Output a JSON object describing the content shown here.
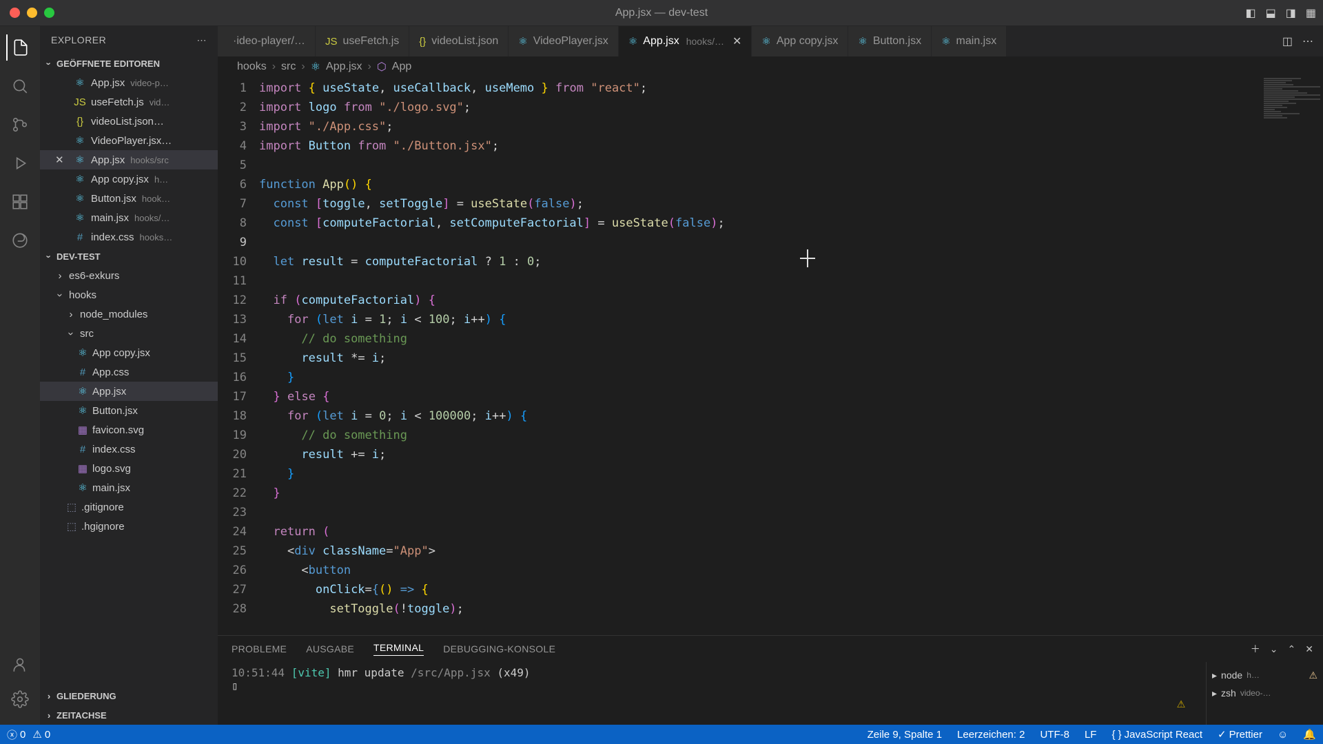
{
  "window": {
    "title": "App.jsx — dev-test"
  },
  "explorer": {
    "title": "EXPLORER",
    "openEditorsLabel": "GEÖFFNETE EDITOREN",
    "projectLabel": "DEV-TEST",
    "outlineLabel": "GLIEDERUNG",
    "timelineLabel": "ZEITACHSE",
    "openEditors": [
      {
        "name": "App.jsx",
        "hint": "video-p…",
        "iconCls": "ic-react",
        "glyph": "⚛"
      },
      {
        "name": "useFetch.js",
        "hint": "vid…",
        "iconCls": "ic-js",
        "glyph": "JS"
      },
      {
        "name": "videoList.json…",
        "hint": "",
        "iconCls": "ic-json",
        "glyph": "{}"
      },
      {
        "name": "VideoPlayer.jsx…",
        "hint": "",
        "iconCls": "ic-react",
        "glyph": "⚛"
      },
      {
        "name": "App.jsx",
        "hint": "hooks/src",
        "iconCls": "ic-react",
        "glyph": "⚛",
        "close": true,
        "active": true
      },
      {
        "name": "App copy.jsx",
        "hint": "h…",
        "iconCls": "ic-react",
        "glyph": "⚛"
      },
      {
        "name": "Button.jsx",
        "hint": "hook…",
        "iconCls": "ic-react",
        "glyph": "⚛"
      },
      {
        "name": "main.jsx",
        "hint": "hooks/…",
        "iconCls": "ic-react",
        "glyph": "⚛"
      },
      {
        "name": "index.css",
        "hint": "hooks…",
        "iconCls": "ic-css",
        "glyph": "#"
      }
    ],
    "tree": [
      {
        "name": "es6-exkurs",
        "kind": "folder",
        "open": false,
        "indent": 1
      },
      {
        "name": "hooks",
        "kind": "folder",
        "open": true,
        "indent": 1
      },
      {
        "name": "node_modules",
        "kind": "folder",
        "open": false,
        "indent": 2
      },
      {
        "name": "src",
        "kind": "folder",
        "open": true,
        "indent": 2
      },
      {
        "name": "App copy.jsx",
        "kind": "file",
        "iconCls": "ic-react",
        "glyph": "⚛",
        "indent": 3
      },
      {
        "name": "App.css",
        "kind": "file",
        "iconCls": "ic-css",
        "glyph": "#",
        "indent": 3
      },
      {
        "name": "App.jsx",
        "kind": "file",
        "iconCls": "ic-react",
        "glyph": "⚛",
        "indent": 3,
        "sel": true
      },
      {
        "name": "Button.jsx",
        "kind": "file",
        "iconCls": "ic-react",
        "glyph": "⚛",
        "indent": 3
      },
      {
        "name": "favicon.svg",
        "kind": "file",
        "iconCls": "ic-svg",
        "glyph": "▦",
        "indent": 3
      },
      {
        "name": "index.css",
        "kind": "file",
        "iconCls": "ic-css",
        "glyph": "#",
        "indent": 3
      },
      {
        "name": "logo.svg",
        "kind": "file",
        "iconCls": "ic-svg",
        "glyph": "▦",
        "indent": 3
      },
      {
        "name": "main.jsx",
        "kind": "file",
        "iconCls": "ic-react",
        "glyph": "⚛",
        "indent": 3
      },
      {
        "name": ".gitignore",
        "kind": "file",
        "iconCls": "ic-txt",
        "glyph": "⬚",
        "indent": 2
      },
      {
        "name": ".hgignore",
        "kind": "file",
        "iconCls": "ic-txt",
        "glyph": "⬚",
        "indent": 2
      }
    ]
  },
  "tabs": [
    {
      "label": "·ideo-player/…",
      "iconCls": "ic-react",
      "glyph": ""
    },
    {
      "label": "useFetch.js",
      "iconCls": "ic-js",
      "glyph": "JS"
    },
    {
      "label": "videoList.json",
      "iconCls": "ic-json",
      "glyph": "{}"
    },
    {
      "label": "VideoPlayer.jsx",
      "iconCls": "ic-react",
      "glyph": "⚛"
    },
    {
      "label": "App.jsx",
      "hint": "hooks/…",
      "iconCls": "ic-react",
      "glyph": "⚛",
      "active": true,
      "close": true
    },
    {
      "label": "App copy.jsx",
      "iconCls": "ic-react",
      "glyph": "⚛"
    },
    {
      "label": "Button.jsx",
      "iconCls": "ic-react",
      "glyph": "⚛"
    },
    {
      "label": "main.jsx",
      "iconCls": "ic-react",
      "glyph": "⚛"
    }
  ],
  "breadcrumb": {
    "p0": "hooks",
    "p1": "src",
    "p2": "App.jsx",
    "p3": "App"
  },
  "panel": {
    "tabs": {
      "probleme": "PROBLEME",
      "ausgabe": "AUSGABE",
      "terminal": "TERMINAL",
      "debug": "DEBUGGING-KONSOLE"
    },
    "term": {
      "time": "10:51:44",
      "tag": "[vite]",
      "msg": "hmr update",
      "path": "/src/App.jsx",
      "count": "(x49)"
    },
    "side": [
      {
        "glyph": "▸",
        "name": "node",
        "hint": "h…",
        "warn": "⚠"
      },
      {
        "glyph": "▸",
        "name": "zsh",
        "hint": "video-…",
        "warn": ""
      }
    ]
  },
  "status": {
    "errors": "0",
    "warnings": "0",
    "pos": "Zeile 9, Spalte 1",
    "spaces": "Leerzeichen: 2",
    "enc": "UTF-8",
    "eol": "LF",
    "lang": "JavaScript React",
    "prettier": "Prettier"
  },
  "code": {
    "lines": [
      1,
      2,
      3,
      4,
      5,
      6,
      7,
      8,
      9,
      10,
      11,
      12,
      13,
      14,
      15,
      16,
      17,
      18,
      19,
      20,
      21,
      22,
      23,
      24,
      25,
      26,
      27,
      28
    ],
    "currentLine": 9,
    "html": [
      "<span class='tk-kw'>import</span> <span class='tk-brace'>{</span> <span class='tk-var'>useState</span>, <span class='tk-var'>useCallback</span>, <span class='tk-var'>useMemo</span> <span class='tk-brace'>}</span> <span class='tk-kw'>from</span> <span class='tk-str'>\"react\"</span>;",
      "<span class='tk-kw'>import</span> <span class='tk-var'>logo</span> <span class='tk-kw'>from</span> <span class='tk-str'>\"./logo.svg\"</span>;",
      "<span class='tk-kw'>import</span> <span class='tk-str'>\"./App.css\"</span>;",
      "<span class='tk-kw'>import</span> <span class='tk-var'>Button</span> <span class='tk-kw'>from</span> <span class='tk-str'>\"./Button.jsx\"</span>;",
      "",
      "<span class='tk-const'>function</span> <span class='tk-fn'>App</span><span class='tk-brace'>()</span> <span class='tk-brace'>{</span>",
      "  <span class='tk-const'>const</span> <span class='tk-brace2'>[</span><span class='tk-var'>toggle</span>, <span class='tk-var'>setToggle</span><span class='tk-brace2'>]</span> = <span class='tk-fn'>useState</span><span class='tk-brace2'>(</span><span class='tk-const'>false</span><span class='tk-brace2'>)</span>;",
      "  <span class='tk-const'>const</span> <span class='tk-brace2'>[</span><span class='tk-var'>computeFactorial</span>, <span class='tk-var'>setComputeFactorial</span><span class='tk-brace2'>]</span> = <span class='tk-fn'>useState</span><span class='tk-brace2'>(</span><span class='tk-const'>false</span><span class='tk-brace2'>)</span>;",
      "",
      "  <span class='tk-const'>let</span> <span class='tk-var'>result</span> = <span class='tk-var'>computeFactorial</span> ? <span class='tk-num'>1</span> : <span class='tk-num'>0</span>;",
      "",
      "  <span class='tk-kw'>if</span> <span class='tk-brace2'>(</span><span class='tk-var'>computeFactorial</span><span class='tk-brace2'>)</span> <span class='tk-brace2'>{</span>",
      "    <span class='tk-kw'>for</span> <span class='tk-brace3'>(</span><span class='tk-const'>let</span> <span class='tk-var'>i</span> = <span class='tk-num'>1</span>; <span class='tk-var'>i</span> &lt; <span class='tk-num'>100</span>; <span class='tk-var'>i</span>++<span class='tk-brace3'>)</span> <span class='tk-brace3'>{</span>",
      "      <span class='tk-comm'>// do something</span>",
      "      <span class='tk-var'>result</span> *= <span class='tk-var'>i</span>;",
      "    <span class='tk-brace3'>}</span>",
      "  <span class='tk-brace2'>}</span> <span class='tk-kw'>else</span> <span class='tk-brace2'>{</span>",
      "    <span class='tk-kw'>for</span> <span class='tk-brace3'>(</span><span class='tk-const'>let</span> <span class='tk-var'>i</span> = <span class='tk-num'>0</span>; <span class='tk-var'>i</span> &lt; <span class='tk-num'>100000</span>; <span class='tk-var'>i</span>++<span class='tk-brace3'>)</span> <span class='tk-brace3'>{</span>",
      "      <span class='tk-comm'>// do something</span>",
      "      <span class='tk-var'>result</span> += <span class='tk-var'>i</span>;",
      "    <span class='tk-brace3'>}</span>",
      "  <span class='tk-brace2'>}</span>",
      "",
      "  <span class='tk-kw'>return</span> <span class='tk-brace2'>(</span>",
      "    &lt;<span class='tk-const'>div</span> <span class='tk-var'>className</span>=<span class='tk-str'>\"App\"</span>&gt;",
      "      &lt;<span class='tk-const'>button</span>",
      "        <span class='tk-var'>onClick</span>=<span class='tk-const'>{</span><span class='tk-brace'>()</span> <span class='tk-const'>=&gt;</span> <span class='tk-brace'>{</span>",
      "          <span class='tk-fn'>setToggle</span><span class='tk-brace2'>(</span>!<span class='tk-var'>toggle</span><span class='tk-brace2'>)</span>;"
    ]
  }
}
